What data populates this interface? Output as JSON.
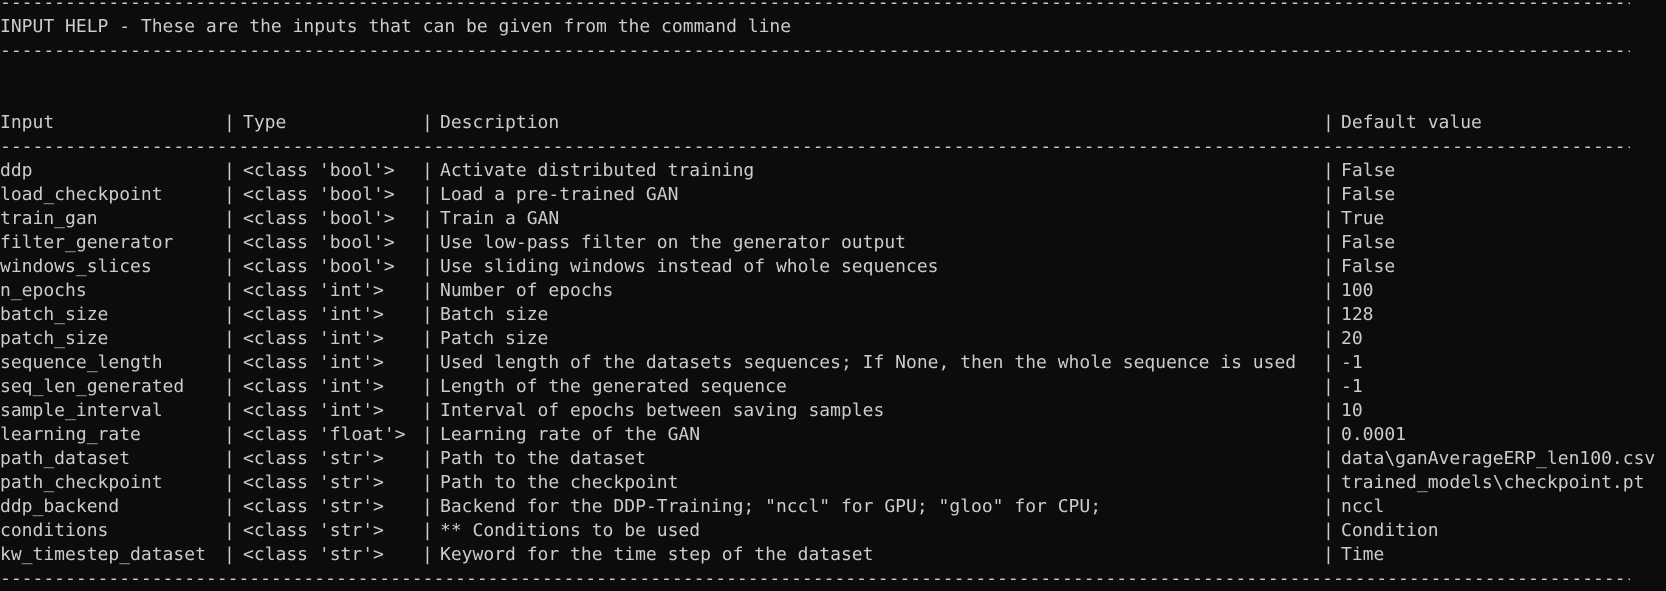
{
  "help_title": "INPUT HELP - These are the inputs that can be given from the command line",
  "columns": {
    "input": "Input",
    "type": "Type",
    "description": "Description",
    "default": "Default value"
  },
  "rows": [
    {
      "input": "ddp",
      "type": "<class 'bool'>",
      "description": "Activate distributed training",
      "default": "False"
    },
    {
      "input": "load_checkpoint",
      "type": "<class 'bool'>",
      "description": "Load a pre-trained GAN",
      "default": "False"
    },
    {
      "input": "train_gan",
      "type": "<class 'bool'>",
      "description": "Train a GAN",
      "default": "True"
    },
    {
      "input": "filter_generator",
      "type": "<class 'bool'>",
      "description": "Use low-pass filter on the generator output",
      "default": "False"
    },
    {
      "input": "windows_slices",
      "type": "<class 'bool'>",
      "description": "Use sliding windows instead of whole sequences",
      "default": "False"
    },
    {
      "input": "n_epochs",
      "type": "<class 'int'>",
      "description": "Number of epochs",
      "default": "100"
    },
    {
      "input": "batch_size",
      "type": "<class 'int'>",
      "description": "Batch size",
      "default": "128"
    },
    {
      "input": "patch_size",
      "type": "<class 'int'>",
      "description": "Patch size",
      "default": "20"
    },
    {
      "input": "sequence_length",
      "type": "<class 'int'>",
      "description": "Used length of the datasets sequences; If None, then the whole sequence is used",
      "default": "-1"
    },
    {
      "input": "seq_len_generated",
      "type": "<class 'int'>",
      "description": "Length of the generated sequence",
      "default": "-1"
    },
    {
      "input": "sample_interval",
      "type": "<class 'int'>",
      "description": "Interval of epochs between saving samples",
      "default": "10"
    },
    {
      "input": "learning_rate",
      "type": "<class 'float'>",
      "description": "Learning rate of the GAN",
      "default": "0.0001"
    },
    {
      "input": "path_dataset",
      "type": "<class 'str'>",
      "description": "Path to the dataset",
      "default": "data\\ganAverageERP_len100.csv"
    },
    {
      "input": "path_checkpoint",
      "type": "<class 'str'>",
      "description": "Path to the checkpoint",
      "default": "trained_models\\checkpoint.pt"
    },
    {
      "input": "ddp_backend",
      "type": "<class 'str'>",
      "description": "Backend for the DDP-Training; \"nccl\" for GPU; \"gloo\" for CPU;",
      "default": "nccl"
    },
    {
      "input": "conditions",
      "type": "<class 'str'>",
      "description": "** Conditions to be used",
      "default": "Condition"
    },
    {
      "input": "kw_timestep_dataset",
      "type": "<class 'str'>",
      "description": "Keyword for the time step of the dataset",
      "default": "Time"
    }
  ]
}
